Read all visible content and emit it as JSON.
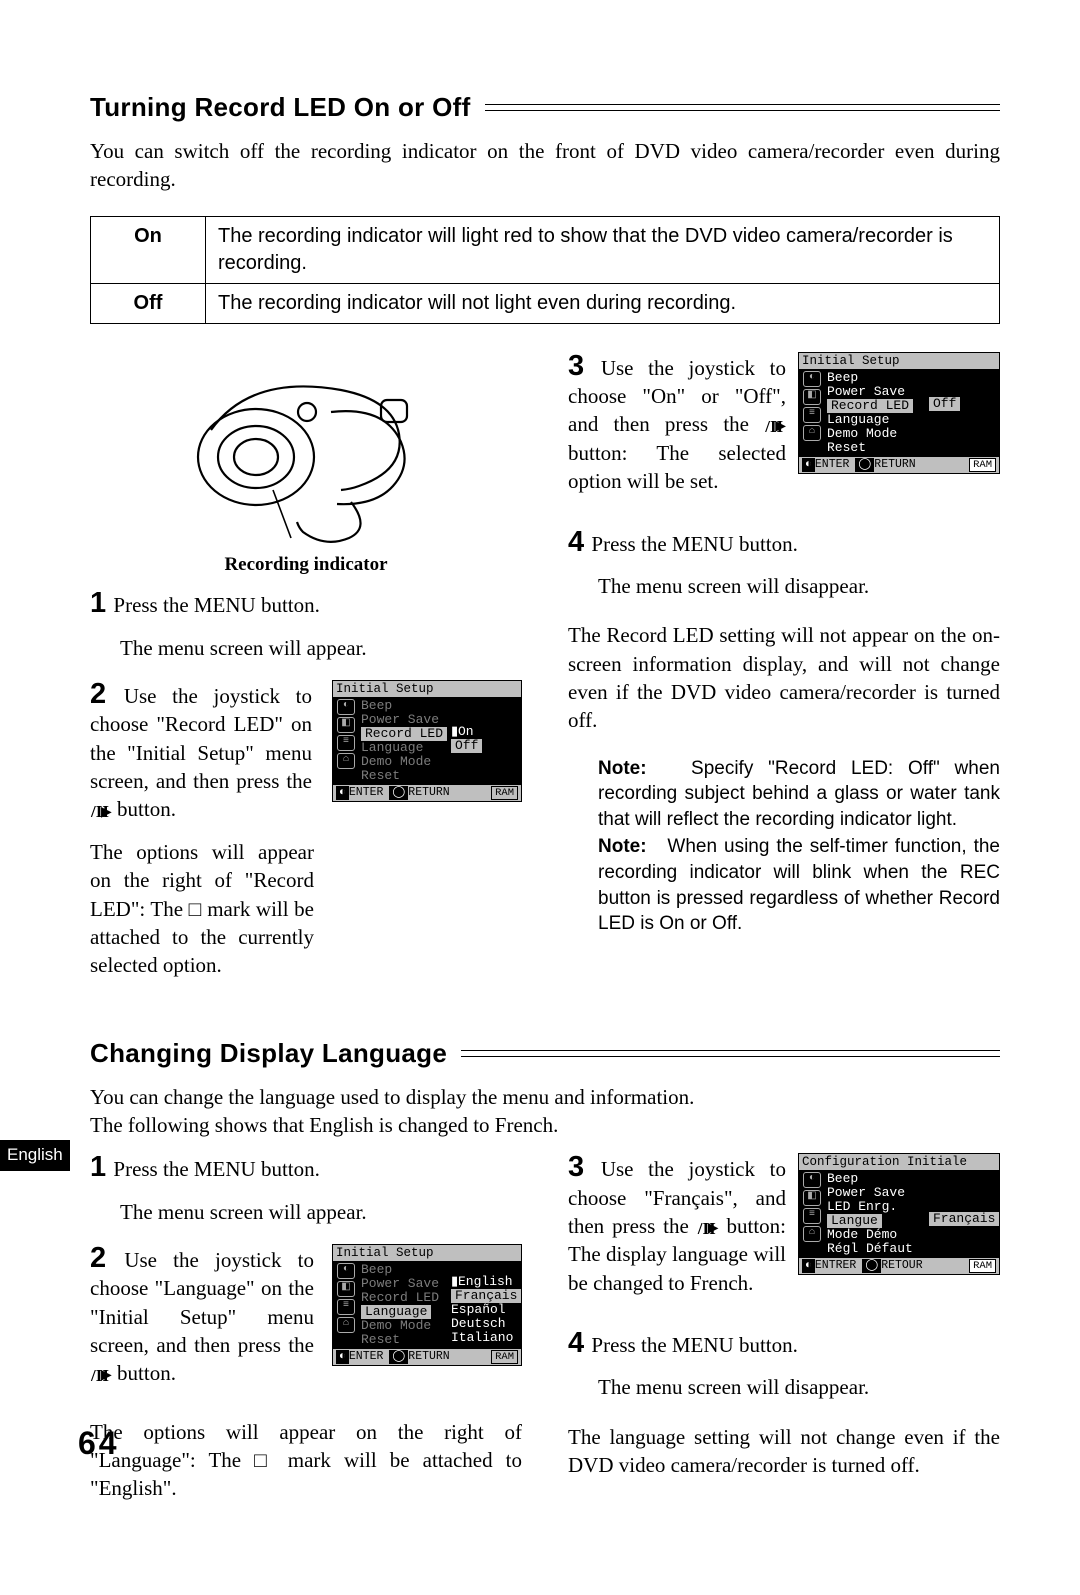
{
  "pageNumber": "64",
  "sideTab": "English",
  "section1": {
    "title": "Turning Record LED On or Off",
    "intro": "You can switch off the recording indicator on the front of DVD video camera/recorder even during recording.",
    "table": {
      "on_k": "On",
      "on_v": "The recording indicator will light red to show that the DVD video camera/recorder is recording.",
      "off_k": "Off",
      "off_v": "The recording indicator will not light even during recording."
    },
    "camera_caption": "Recording indicator",
    "left": {
      "s1a": "Press the MENU button.",
      "s1b": "The menu screen will appear.",
      "s2a_1": "Use the joystick to choose \"Record LED\" on the \"Initial Setup\" menu screen, and then press the",
      "s2a_2": " button.",
      "s2b": "The options will appear on the right of \"Record LED\": The □ mark will be attached to the currently selected option."
    },
    "right": {
      "s3a_1": "Use the joystick to choose \"On\" or \"Off\", and then press the",
      "s3a_2": " button: The selected option will be set.",
      "s4a": "Press the MENU button.",
      "s4b": "The menu screen will disappear.",
      "note_after": "The Record LED setting will not appear on the on-screen information display, and will not change even if the DVD video camera/recorder is turned off.",
      "note1_lbl": "Note:",
      "note1": "Specify \"Record LED: Off\" when recording subject behind a glass or water tank that will reflect the recording indicator light.",
      "note2_lbl": "Note:",
      "note2": "When using the self-timer function, the recording indicator will blink when the REC button is pressed regardless of whether Record LED is On or Off."
    },
    "menuA": {
      "title": "Initial Setup",
      "items": [
        "Beep",
        "Power Save",
        "Record LED",
        "Language",
        "Demo Mode",
        "Reset"
      ],
      "selected": 2,
      "sub": [
        "On",
        "Off"
      ],
      "sub_sel": 0,
      "enter": "ENTER",
      "return": "RETURN",
      "ram": "RAM"
    },
    "menuB": {
      "title": "Initial Setup",
      "items": [
        "Beep",
        "Power Save",
        "Record LED",
        "Language",
        "Demo Mode",
        "Reset"
      ],
      "selected": 2,
      "sub_one": "Off",
      "enter": "ENTER",
      "return": "RETURN",
      "ram": "RAM"
    }
  },
  "section2": {
    "title": "Changing Display Language",
    "intro1": "You can change the language used to display the menu and information.",
    "intro2": "The following shows that English is changed to French.",
    "left": {
      "s1a": "Press the MENU button.",
      "s1b": "The menu screen will appear.",
      "s2a_1": "Use the joystick to choose \"Language\" on the \"Initial Setup\" menu screen, and then press the",
      "s2a_2": " button.",
      "s2b": "The options will appear on the right of \"Language\": The □ mark will be attached to \"English\"."
    },
    "right": {
      "s3a_1": "Use the joystick to choose \"Français\", and then press the",
      "s3a_2": " button: The display language will be changed to French.",
      "s4a": "Press the MENU button.",
      "s4b": "The menu screen will disappear.",
      "note_after": "The language setting will not change even if the DVD video camera/recorder is turned off."
    },
    "menuA": {
      "title": "Initial Setup",
      "items": [
        "Beep",
        "Power Save",
        "Record LED",
        "Language",
        "Demo Mode",
        "Reset"
      ],
      "selected": 3,
      "sub": [
        "English",
        "Français",
        "Español",
        "Deutsch",
        "Italiano"
      ],
      "sub_sel": 0,
      "enter": "ENTER",
      "return": "RETURN",
      "ram": "RAM"
    },
    "menuB": {
      "title": "Configuration Initiale",
      "items": [
        "Beep",
        "Power Save",
        "LED Enrg.",
        "Langue",
        "Mode Démo",
        "Régl Défaut"
      ],
      "selected": 3,
      "sub_one": "Français",
      "enter": "ENTRER",
      "return": "RETOUR",
      "ram": "RAM"
    }
  }
}
